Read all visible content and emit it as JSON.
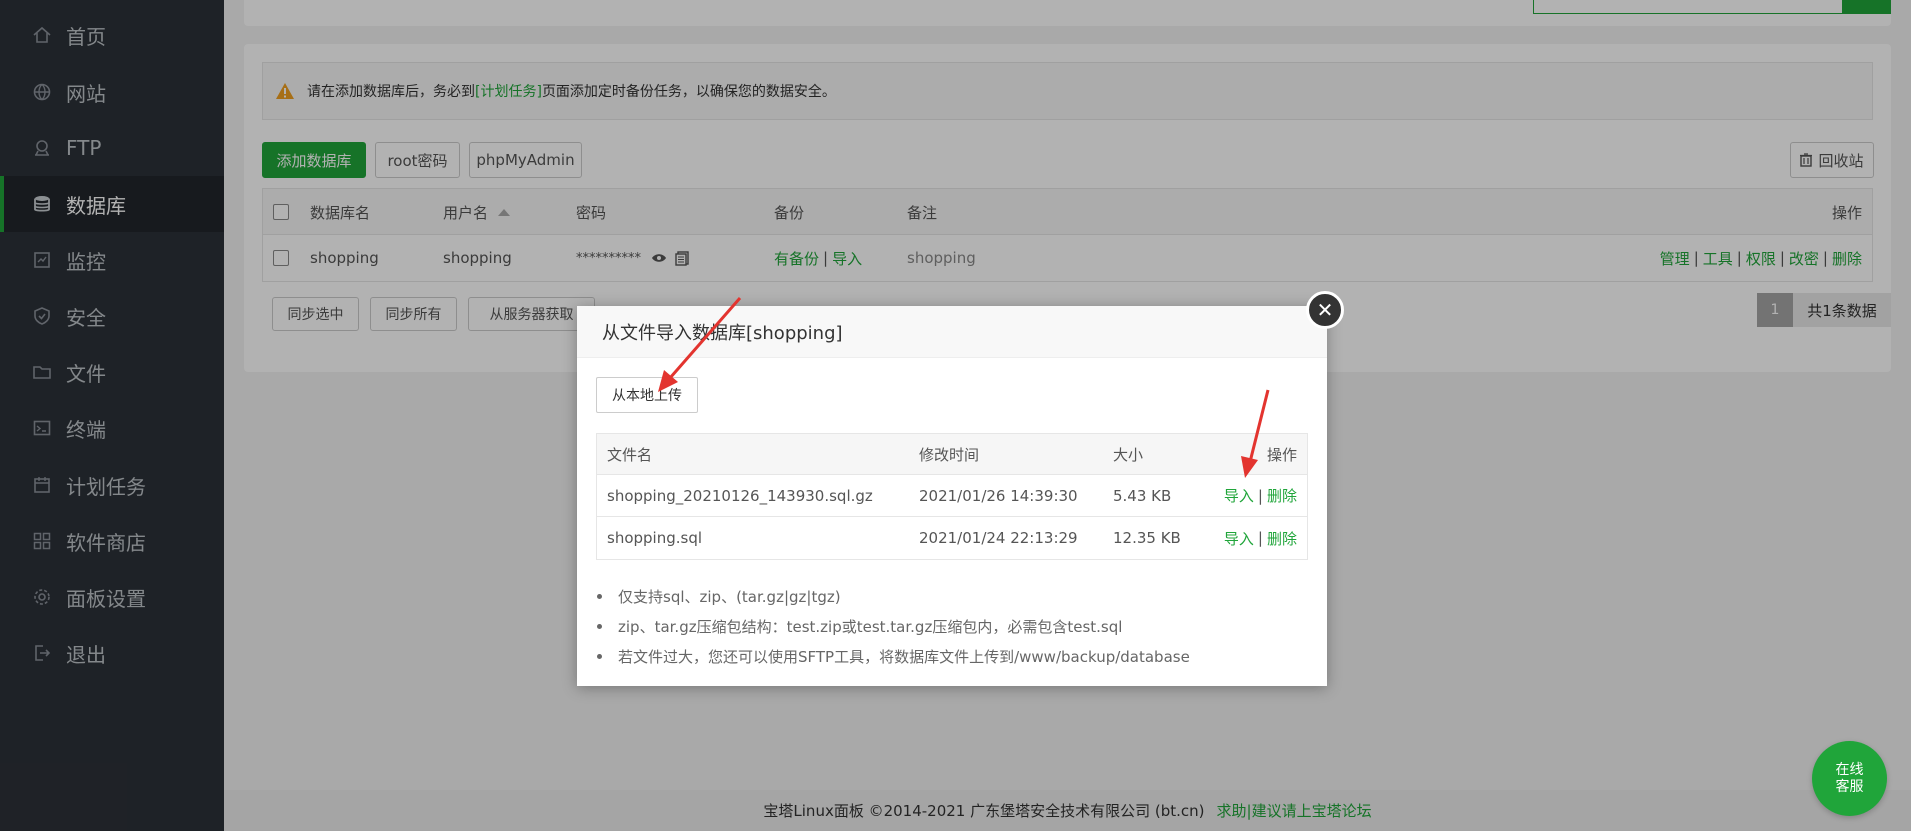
{
  "sidebar": {
    "items": [
      {
        "label": "首页",
        "icon": "home-icon"
      },
      {
        "label": "网站",
        "icon": "globe-icon"
      },
      {
        "label": "FTP",
        "icon": "ftp-icon"
      },
      {
        "label": "数据库",
        "icon": "database-icon",
        "active": true
      },
      {
        "label": "监控",
        "icon": "monitor-icon"
      },
      {
        "label": "安全",
        "icon": "shield-icon"
      },
      {
        "label": "文件",
        "icon": "folder-icon"
      },
      {
        "label": "终端",
        "icon": "terminal-icon"
      },
      {
        "label": "计划任务",
        "icon": "calendar-icon"
      },
      {
        "label": "软件商店",
        "icon": "grid-icon"
      },
      {
        "label": "面板设置",
        "icon": "gear-icon"
      },
      {
        "label": "退出",
        "icon": "logout-icon"
      }
    ]
  },
  "alert": {
    "before": "请在添加数据库后，务必到",
    "link": "[计划任务]",
    "after": "页面添加定时备份任务，以确保您的数据安全。"
  },
  "toolbar": {
    "add_db": "添加数据库",
    "root_pw": "root密码",
    "phpmyadmin": "phpMyAdmin",
    "recycle": "回收站"
  },
  "db_table": {
    "headers": {
      "name": "数据库名",
      "user": "用户名",
      "password": "密码",
      "backup": "备份",
      "remark": "备注",
      "actions": "操作"
    },
    "rows": [
      {
        "name": "shopping",
        "user": "shopping",
        "password": "**********",
        "backup_status": "有备份",
        "backup_import": "导入",
        "remark": "shopping",
        "actions": [
          "管理",
          "工具",
          "权限",
          "改密",
          "删除"
        ]
      }
    ]
  },
  "bottom_buttons": {
    "sync_selected": "同步选中",
    "sync_all": "同步所有",
    "from_server": "从服务器获取"
  },
  "pager": {
    "current": "1",
    "total": "共1条数据"
  },
  "modal": {
    "title": "从文件导入数据库[shopping]",
    "upload": "从本地上传",
    "headers": {
      "file": "文件名",
      "mtime": "修改时间",
      "size": "大小",
      "actions": "操作"
    },
    "files": [
      {
        "name": "shopping_20210126_143930.sql.gz",
        "mtime": "2021/01/26 14:39:30",
        "size": "5.43 KB",
        "import": "导入",
        "delete": "删除"
      },
      {
        "name": "shopping.sql",
        "mtime": "2021/01/24 22:13:29",
        "size": "12.35 KB",
        "import": "导入",
        "delete": "删除"
      }
    ],
    "notes": [
      "仅支持sql、zip、(tar.gz|gz|tgz)",
      "zip、tar.gz压缩包结构：test.zip或test.tar.gz压缩包内，必需包含test.sql",
      "若文件过大，您还可以使用SFTP工具，将数据库文件上传到/www/backup/database"
    ]
  },
  "footer": {
    "text": "宝塔Linux面板 ©2014-2021 广东堡塔安全技术有限公司 (bt.cn)",
    "link": "求助|建议请上宝塔论坛"
  },
  "chat": {
    "line1": "在线",
    "line2": "客服"
  },
  "colors": {
    "accent": "#20a53a",
    "sidebar": "#2c3138",
    "arrow": "#e3342f"
  }
}
